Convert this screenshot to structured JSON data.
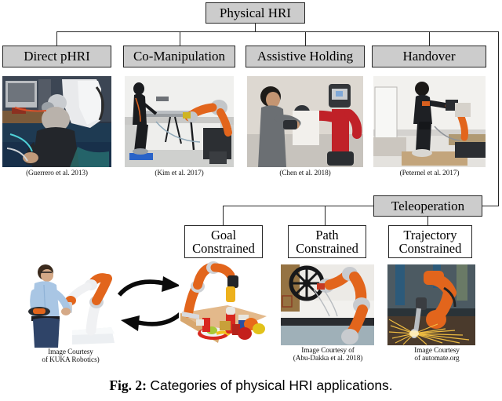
{
  "figure": {
    "caption_label": "Fig. 2:",
    "caption_text": "Categories of physical HRI applications."
  },
  "tree": {
    "root": {
      "label": "Physical HRI"
    },
    "level1": [
      {
        "label": "Direct pHRI",
        "citation": "(Guerrero et al. 2013)"
      },
      {
        "label": "Co-Manipulation",
        "citation": "(Kim et al. 2017)"
      },
      {
        "label": "Assistive Holding",
        "citation": "(Chen et al. 2018)"
      },
      {
        "label": "Handover",
        "citation": "(Peternel et al. 2017)"
      }
    ],
    "teleoperation": {
      "label": "Teleoperation"
    },
    "level2": [
      {
        "label_line1": "Goal",
        "label_line2": "Constrained",
        "citation_line1": "Image Courtesy",
        "citation_line2": "of KUKA Robotics)"
      },
      {
        "label_line1": "Path",
        "label_line2": "Constrained",
        "citation_line1": "Image Courtesy of",
        "citation_line2": "(Abu-Dakka et al. 2018)"
      },
      {
        "label_line1": "Trajectory",
        "label_line2": "Constrained",
        "citation_line1": "Image Courtesy",
        "citation_line2": "of automate.org"
      }
    ]
  },
  "colors": {
    "box_fill_shaded": "#cccccc",
    "box_fill_plain": "#ffffff",
    "line": "#262626",
    "robot_orange": "#e2651c",
    "robot_red": "#c02128",
    "text": "#000000"
  },
  "photos": {
    "direct_phri": {
      "alt": "man seated operating white industrial robot arm in lab"
    },
    "co_manipulation": {
      "alt": "person in motion-capture suit co-carrying a table with orange robot arm"
    },
    "assistive_holding": {
      "alt": "man holding board against red Baxter robot"
    },
    "handover": {
      "alt": "man on platform handing object to orange robot arm"
    },
    "kuka_demo": {
      "alt": "man in blue shirt guiding white and orange KUKA LWR arm"
    },
    "goal_constrained": {
      "alt": "orange robot arm grasping objects on a table of groceries"
    },
    "path_constrained": {
      "alt": "orange robot arm turning a black valve wheel"
    },
    "trajectory_constrained": {
      "alt": "orange industrial robot welding with sparks"
    }
  }
}
